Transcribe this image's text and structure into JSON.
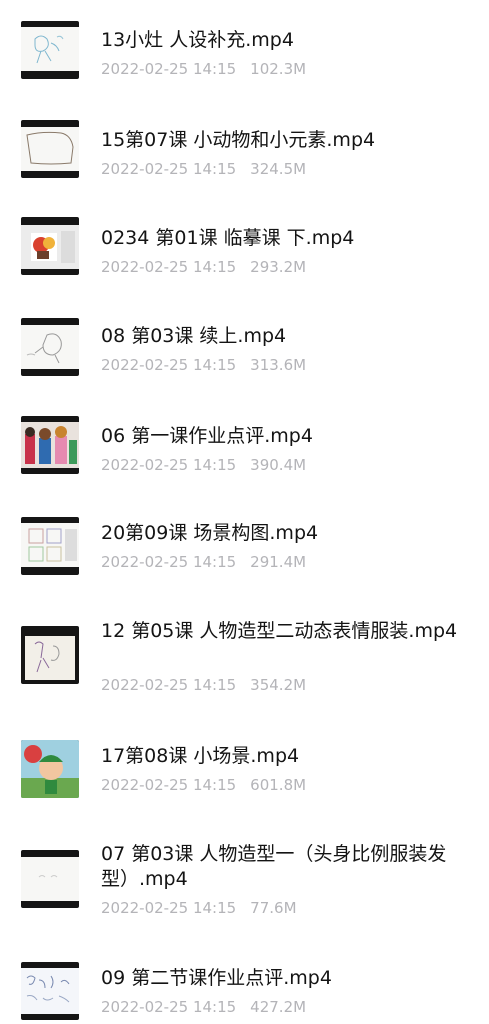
{
  "files": [
    {
      "name": "13小灶 人设补充.mp4",
      "date": "2022-02-25 14:15",
      "size": "102.3M",
      "thumb": "sketch-blue"
    },
    {
      "name": "15第07课 小动物和小元素.mp4",
      "date": "2022-02-25 14:15",
      "size": "324.5M",
      "thumb": "sketch-outline"
    },
    {
      "name": "0234 第01课 临摹课 下.mp4",
      "date": "2022-02-25 14:15",
      "size": "293.2M",
      "thumb": "color-character"
    },
    {
      "name": "08 第03课 续上.mp4",
      "date": "2022-02-25 14:15",
      "size": "313.6M",
      "thumb": "sketch-head"
    },
    {
      "name": "06 第一课作业点评.mp4",
      "date": "2022-02-25 14:15",
      "size": "390.4M",
      "thumb": "color-figures"
    },
    {
      "name": "20第09课 场景构图.mp4",
      "date": "2022-02-25 14:15",
      "size": "291.4M",
      "thumb": "sketch-grid"
    },
    {
      "name": "12 第05课 人物造型二动态表情服装.mp4",
      "date": "2022-02-25 14:15",
      "size": "354.2M",
      "thumb": "sketch-dark"
    },
    {
      "name": "17第08课 小场景.mp4",
      "date": "2022-02-25 14:15",
      "size": "601.8M",
      "thumb": "color-scene"
    },
    {
      "name": "07 第03课 人物造型一（头身比例服装发型）.mp4",
      "date": "2022-02-25 14:15",
      "size": "77.6M",
      "thumb": "sketch-faint"
    },
    {
      "name": "09 第二节课作业点评.mp4",
      "date": "2022-02-25 14:15",
      "size": "427.2M",
      "thumb": "sketch-sheet"
    }
  ]
}
